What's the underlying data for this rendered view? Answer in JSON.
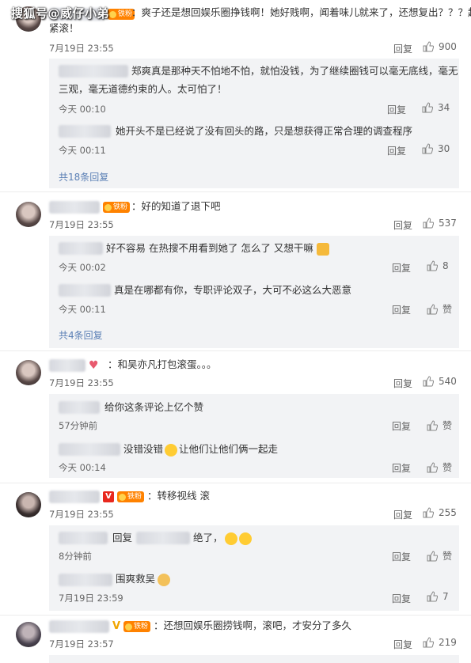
{
  "watermark": "搜狐号@威仔小弟",
  "ui": {
    "reply": "回复",
    "like_zan": "赞"
  },
  "comments": [
    {
      "text_line1": "：爽子还是想回娱乐圈挣钱啊！她好贱啊，闻着味儿就来了，还想复出？？？赶",
      "text_line2": "紧滚！",
      "time": "7月19日 23:55",
      "likes": "900",
      "replies": [
        {
          "text_line1": "郑爽真是那种天不怕地不怕，就怕没钱，为了继续圈钱可以毫无底线，毫无",
          "text_line2": "三观，毫无道德约束的人。太可怕了！",
          "time": "今天 00:10",
          "likes": "34"
        },
        {
          "text": "她开头不是已经说了没有回头的路，只是想获得正常合理的调查程序",
          "time": "今天 00:11",
          "likes": "30"
        }
      ],
      "more": "共18条回复"
    },
    {
      "text": "：好的知道了退下吧",
      "time": "7月19日 23:55",
      "likes": "537",
      "replies": [
        {
          "text": "好不容易 在热搜不用看到她了 怎么了 又想干嘛",
          "time": "今天 00:02",
          "likes": "8"
        },
        {
          "text": "真是在哪都有你，专职评论双子，大可不必这么大恶意",
          "time": "今天 00:11",
          "likes": ""
        }
      ],
      "more": "共4条回复"
    },
    {
      "text": "：和吴亦凡打包滚蛋。。。",
      "time": "7月19日 23:55",
      "likes": "540",
      "replies": [
        {
          "text": "给你这条评论上亿个赞",
          "time": "57分钟前",
          "likes": ""
        },
        {
          "text_a": "没错没错",
          "text_b": "让他们让他们俩一起走",
          "time": "今天 00:14",
          "likes": ""
        }
      ]
    },
    {
      "text": "：转移视线 滚",
      "time": "7月19日 23:55",
      "likes": "255",
      "replies": [
        {
          "text_a": "回复",
          "text_b": "绝了，",
          "time": "8分钟前",
          "likes": ""
        },
        {
          "text": "围爽救吴",
          "time": "7月19日 23:59",
          "likes": "7"
        }
      ]
    },
    {
      "text": "：还想回娱乐圈捞钱啊，滚吧，才安分了多久",
      "time": "7月19日 23:57",
      "likes": "219"
    }
  ]
}
